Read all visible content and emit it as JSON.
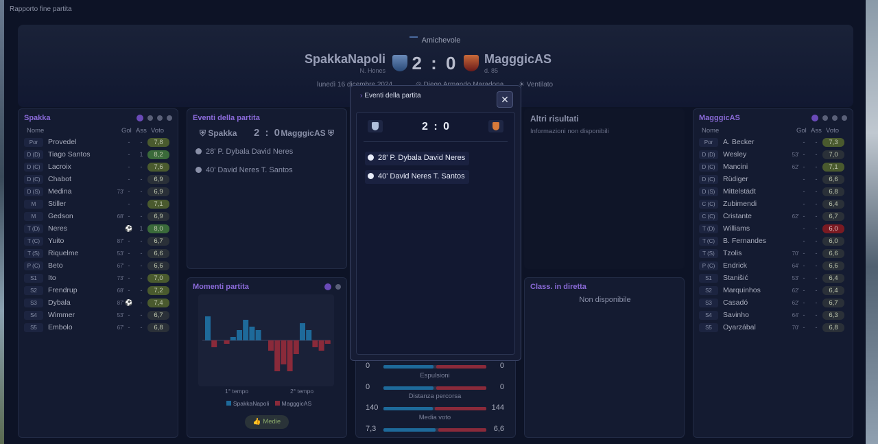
{
  "window": {
    "title": "Rapporto fine partita"
  },
  "match": {
    "competition": "Amichevole",
    "home": {
      "name": "SpakkaNapoli",
      "coach": "N. Hones"
    },
    "away": {
      "name": "MagggicAS",
      "coach": "d. 85"
    },
    "score": "2 : 0",
    "date": "lunedì 16 dicembre 2024",
    "stadium": "Diego Armando Maradona",
    "weather": "Ventilato"
  },
  "home_roster": {
    "title": "Spakka",
    "headers": {
      "name": "Nome",
      "goals": "Gol",
      "assists": "Ass",
      "vote": "Voto"
    },
    "players": [
      {
        "pos": "Por",
        "name": "Provedel",
        "sub": "",
        "gol": "-",
        "ass": "-",
        "vote": "7,8",
        "tone": "md"
      },
      {
        "pos": "D (D)",
        "name": "Tiago Santos",
        "sub": "",
        "gol": "-",
        "ass": "1",
        "vote": "8,2",
        "tone": "hi"
      },
      {
        "pos": "D (C)",
        "name": "Lacroix",
        "sub": "",
        "gol": "-",
        "ass": "-",
        "vote": "7,6",
        "tone": "md"
      },
      {
        "pos": "D (C)",
        "name": "Chabot",
        "sub": "",
        "gol": "-",
        "ass": "-",
        "vote": "6,9",
        "tone": ""
      },
      {
        "pos": "D (S)",
        "name": "Medina",
        "sub": "73'",
        "gol": "-",
        "ass": "-",
        "vote": "6,9",
        "tone": ""
      },
      {
        "pos": "M",
        "name": "Stiller",
        "sub": "",
        "gol": "-",
        "ass": "-",
        "vote": "7,1",
        "tone": "md"
      },
      {
        "pos": "M",
        "name": "Gedson",
        "sub": "68'",
        "gol": "-",
        "ass": "-",
        "vote": "6,9",
        "tone": ""
      },
      {
        "pos": "T (D)",
        "name": "Neres",
        "sub": "",
        "gol": "⚽",
        "ass": "1",
        "vote": "8,0",
        "tone": "hi"
      },
      {
        "pos": "T (C)",
        "name": "Yuito",
        "sub": "87'",
        "gol": "-",
        "ass": "-",
        "vote": "6,7",
        "tone": ""
      },
      {
        "pos": "T (S)",
        "name": "Riquelme",
        "sub": "53'",
        "gol": "-",
        "ass": "-",
        "vote": "6,6",
        "tone": ""
      },
      {
        "pos": "P (C)",
        "name": "Beto",
        "sub": "67'",
        "gol": "-",
        "ass": "-",
        "vote": "6,6",
        "tone": ""
      },
      {
        "pos": "S1",
        "name": "Ito",
        "sub": "73'",
        "gol": "-",
        "ass": "-",
        "vote": "7,0",
        "tone": "md"
      },
      {
        "pos": "S2",
        "name": "Frendrup",
        "sub": "68'",
        "gol": "-",
        "ass": "-",
        "vote": "7,2",
        "tone": "md"
      },
      {
        "pos": "S3",
        "name": "Dybala",
        "sub": "87'",
        "gol": "⚽",
        "ass": "-",
        "vote": "7,4",
        "tone": "md"
      },
      {
        "pos": "S4",
        "name": "Wimmer",
        "sub": "53'",
        "gol": "-",
        "ass": "-",
        "vote": "6,7",
        "tone": ""
      },
      {
        "pos": "S5",
        "name": "Embolo",
        "sub": "67'",
        "gol": "-",
        "ass": "-",
        "vote": "6,8",
        "tone": ""
      }
    ]
  },
  "away_roster": {
    "title": "MagggicAS",
    "headers": {
      "name": "Nome",
      "goals": "Gol",
      "assists": "Ass",
      "vote": "Voto"
    },
    "players": [
      {
        "pos": "Por",
        "name": "A. Becker",
        "sub": "",
        "gol": "-",
        "ass": "-",
        "vote": "7,3",
        "tone": "md"
      },
      {
        "pos": "D (D)",
        "name": "Wesley",
        "sub": "53'",
        "gol": "-",
        "ass": "-",
        "vote": "7,0",
        "tone": ""
      },
      {
        "pos": "D (C)",
        "name": "Mancini",
        "sub": "62'",
        "gol": "-",
        "ass": "-",
        "vote": "7,1",
        "tone": "md"
      },
      {
        "pos": "D (C)",
        "name": "Rüdiger",
        "sub": "",
        "gol": "-",
        "ass": "-",
        "vote": "6,6",
        "tone": ""
      },
      {
        "pos": "D (S)",
        "name": "Mittelstädt",
        "sub": "",
        "gol": "-",
        "ass": "-",
        "vote": "6,8",
        "tone": ""
      },
      {
        "pos": "C (C)",
        "name": "Zubimendi",
        "sub": "",
        "gol": "-",
        "ass": "-",
        "vote": "6,4",
        "tone": ""
      },
      {
        "pos": "C (C)",
        "name": "Cristante",
        "sub": "62'",
        "gol": "-",
        "ass": "-",
        "vote": "6,7",
        "tone": ""
      },
      {
        "pos": "T (D)",
        "name": "Williams",
        "sub": "",
        "gol": "-",
        "ass": "-",
        "vote": "6,0",
        "tone": "lo"
      },
      {
        "pos": "T (C)",
        "name": "B. Fernandes",
        "sub": "",
        "gol": "-",
        "ass": "-",
        "vote": "6,0",
        "tone": ""
      },
      {
        "pos": "T (S)",
        "name": "Tzolis",
        "sub": "70'",
        "gol": "-",
        "ass": "-",
        "vote": "6,6",
        "tone": ""
      },
      {
        "pos": "P (C)",
        "name": "Endrick",
        "sub": "64'",
        "gol": "-",
        "ass": "-",
        "vote": "6,6",
        "tone": ""
      },
      {
        "pos": "S1",
        "name": "Stanišić",
        "sub": "53'",
        "gol": "-",
        "ass": "-",
        "vote": "6,4",
        "tone": ""
      },
      {
        "pos": "S2",
        "name": "Marquinhos",
        "sub": "62'",
        "gol": "-",
        "ass": "-",
        "vote": "6,4",
        "tone": ""
      },
      {
        "pos": "S3",
        "name": "Casadó",
        "sub": "62'",
        "gol": "-",
        "ass": "-",
        "vote": "6,7",
        "tone": ""
      },
      {
        "pos": "S4",
        "name": "Savinho",
        "sub": "64'",
        "gol": "-",
        "ass": "-",
        "vote": "6,3",
        "tone": ""
      },
      {
        "pos": "S5",
        "name": "Oyarzábal",
        "sub": "70'",
        "gol": "-",
        "ass": "-",
        "vote": "6,8",
        "tone": ""
      }
    ]
  },
  "events_panel": {
    "title": "Eventi della partita",
    "home": "Spakka",
    "away": "MagggicAS",
    "score": "2 : 0",
    "events": [
      "28' P. Dybala David Neres",
      "40' David Neres T. Santos"
    ]
  },
  "moments_panel": {
    "title": "Momenti partita",
    "half1": "1° tempo",
    "half2": "2° tempo",
    "legend_home": "SpakkaNapoli",
    "legend_away": "MagggicAS",
    "button": "Medie"
  },
  "chart_data": {
    "type": "bar",
    "series": [
      {
        "name": "SpakkaNapoli",
        "values": [
          7,
          0,
          0,
          0,
          1,
          3,
          6,
          4,
          3,
          0,
          0,
          0,
          0,
          0,
          0,
          5,
          3,
          0,
          0,
          0
        ]
      },
      {
        "name": "MagggicAS",
        "values": [
          0,
          2,
          0,
          1,
          0,
          0,
          0,
          0,
          0,
          0,
          3,
          9,
          7,
          9,
          4,
          0,
          0,
          2,
          3,
          1
        ]
      }
    ]
  },
  "other_results": {
    "title": "Altri risultati",
    "text": "Informazioni non disponibili"
  },
  "live_table": {
    "title": "Class. in diretta",
    "text": "Non disponibile"
  },
  "stats": [
    {
      "label": "",
      "home": "0",
      "away": "0",
      "hf": 0.5,
      "af": 0.5
    },
    {
      "label": "Espulsioni",
      "home": "0",
      "away": "0",
      "hf": 0.5,
      "af": 0.5
    },
    {
      "label": "Distanza percorsa",
      "home": "140",
      "away": "144",
      "hf": 0.49,
      "af": 0.51
    },
    {
      "label": "Media voto",
      "home": "7,3",
      "away": "6,6",
      "hf": 0.52,
      "af": 0.48
    }
  ],
  "modal": {
    "title": "Eventi della partita",
    "close": "✕",
    "score": "2 : 0",
    "events": [
      "28' P. Dybala David Neres",
      "40' David Neres T. Santos"
    ]
  }
}
